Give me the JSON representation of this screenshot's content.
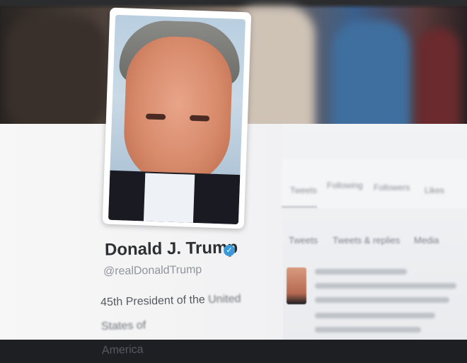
{
  "profile": {
    "name": "Donald J. Trump",
    "handle": "@realDonaldTrump",
    "bio_line1": "45th President of the",
    "bio_line1_blur": "United States of",
    "bio_line2": "America"
  },
  "nav": {
    "tabs": [
      "Tweets",
      "Following",
      "Followers",
      "Likes"
    ]
  },
  "stream": {
    "tabs": [
      "Tweets",
      "Tweets & replies",
      "Media"
    ]
  },
  "icons": {
    "verified": "verified-badge-icon"
  },
  "colors": {
    "verified": "#3a9ad9",
    "name": "#2d2f33",
    "handle": "#8f959c"
  }
}
